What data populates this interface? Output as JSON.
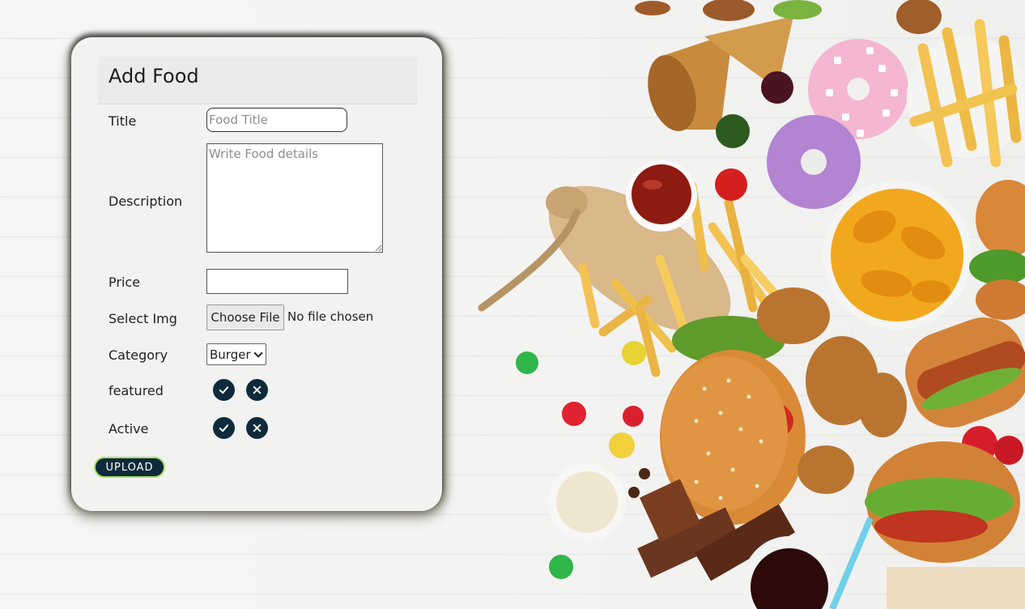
{
  "form": {
    "title": "Add Food",
    "fields": {
      "title_label": "Title",
      "title_placeholder": "Food Title",
      "title_value": "",
      "description_label": "Description",
      "description_placeholder": "Write Food details",
      "description_value": "",
      "price_label": "Price",
      "price_value": "",
      "image_label": "Select Img",
      "file_button": "Choose File",
      "file_status": "No file chosen",
      "category_label": "Category",
      "category_selected": "Burger",
      "featured_label": "featured",
      "active_label": "Active"
    },
    "submit_label": "UPLOAD",
    "icons": {
      "confirm": "check-circle-icon",
      "cancel": "x-circle-icon"
    }
  },
  "colors": {
    "accent_dark": "#0f2b3b",
    "accent_green": "#a4e066",
    "card_background": "#f2f2f1"
  }
}
